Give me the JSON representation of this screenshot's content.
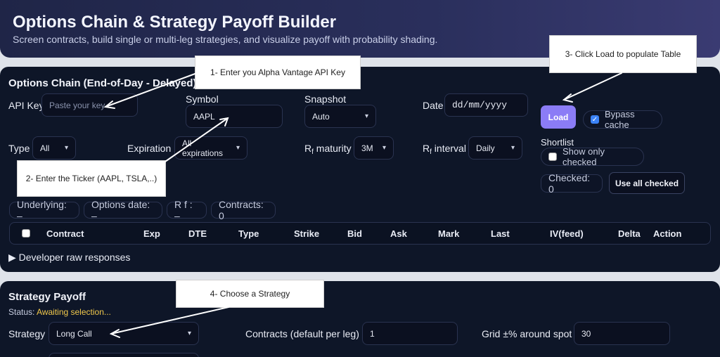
{
  "header": {
    "title": "Options Chain & Strategy Payoff Builder",
    "subtitle": "Screen contracts, build single or multi-leg strategies, and visualize payoff with probability shading."
  },
  "chain": {
    "title": "Options Chain (End-of-Day - Delayed)",
    "api_key_label": "API Key",
    "api_key_placeholder": "Paste your key",
    "symbol_label": "Symbol",
    "symbol_value": "AAPL",
    "snapshot_label": "Snapshot",
    "snapshot_value": "Auto",
    "date_label": "Date",
    "date_value": "dd/mm/yyyy",
    "load_label": "Load",
    "bypass_cache_label": "Bypass cache",
    "type_label": "Type",
    "type_value": "All",
    "expiration_label": "Expiration",
    "expiration_value": "All expirations",
    "rf_maturity_label_main": "R",
    "rf_maturity_label_sub": "f",
    "rf_maturity_label_rest": " maturity",
    "rf_maturity_value": "3M",
    "rf_interval_label_main": "R",
    "rf_interval_label_sub": "f",
    "rf_interval_label_rest": " interval",
    "rf_interval_value": "Daily",
    "shortlist_label": "Shortlist",
    "show_only_checked_label": "Show only checked",
    "checked_count": "Checked: 0",
    "use_all_checked_label": "Use all checked",
    "underlying_chip": "Underlying: –",
    "options_date_chip": "Options date: –",
    "rf_chip": "R f : –",
    "contracts_chip": "Contracts: 0",
    "columns": [
      "Contract",
      "Exp",
      "DTE",
      "Type",
      "Strike",
      "Bid",
      "Ask",
      "Mark",
      "Last",
      "IV(feed)",
      "Delta",
      "Action"
    ],
    "dev_raw": "▶ Developer raw responses"
  },
  "payoff": {
    "title": "Strategy Payoff",
    "status_label": "Status: ",
    "status_value": "Awaiting selection...",
    "strategy_label": "Strategy",
    "strategy_value": "Long Call",
    "contracts_label": "Contracts (default per leg)",
    "contracts_value": "1",
    "grid_label": "Grid ±% around spot",
    "grid_value": "30"
  },
  "callouts": {
    "c1": "1- Enter you Alpha Vantage API Key",
    "c2": "2- Enter the Ticker (AAPL, TSLA,..)",
    "c3": "3- Click Load to populate Table",
    "c4": "4- Choose a Strategy"
  },
  "colors": {
    "card_bg": "#0e1628",
    "accent_button": "#8b7cf6",
    "status_value": "#f1c84b",
    "checkbox_checked": "#3b82f6"
  }
}
